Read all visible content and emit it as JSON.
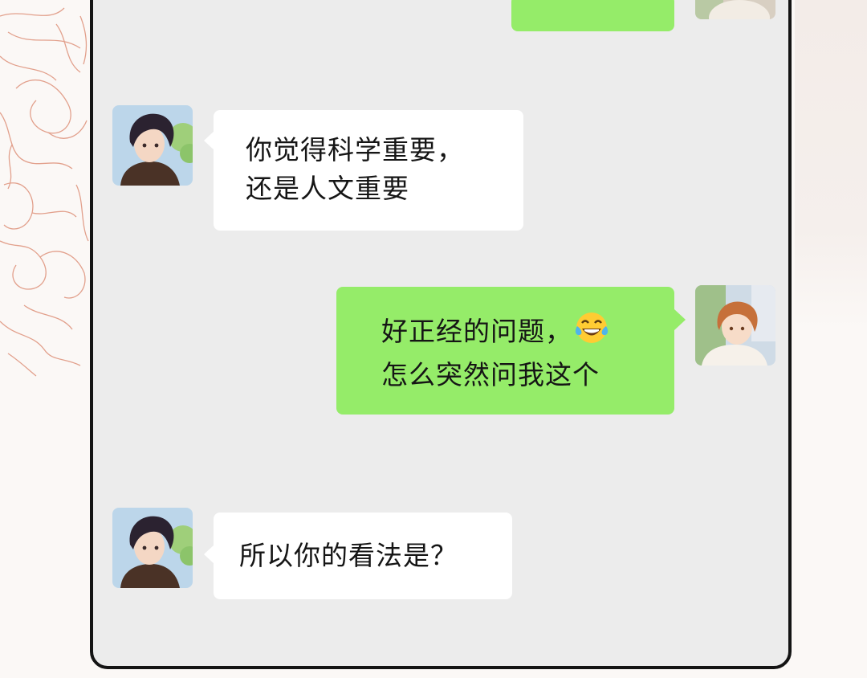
{
  "chat": {
    "messages": [
      {
        "sender": "other",
        "avatar": "boy-dark-hair-avatar",
        "lines": [
          "你觉得科学重要，",
          "还是人文重要"
        ]
      },
      {
        "sender": "me",
        "avatar": "boy-auburn-hair-avatar",
        "lines": [
          "好正经的问题，",
          "怎么突然问我这个"
        ],
        "emoji": "tears-of-joy-emoji"
      },
      {
        "sender": "other",
        "avatar": "boy-dark-hair-avatar",
        "lines": [
          "所以你的看法是？"
        ]
      }
    ]
  },
  "colors": {
    "chat_background": "#ececec",
    "green_bubble": "#95ec69",
    "white_bubble": "#ffffff",
    "frame": "#141414",
    "floral_line": "#e2a08c"
  }
}
